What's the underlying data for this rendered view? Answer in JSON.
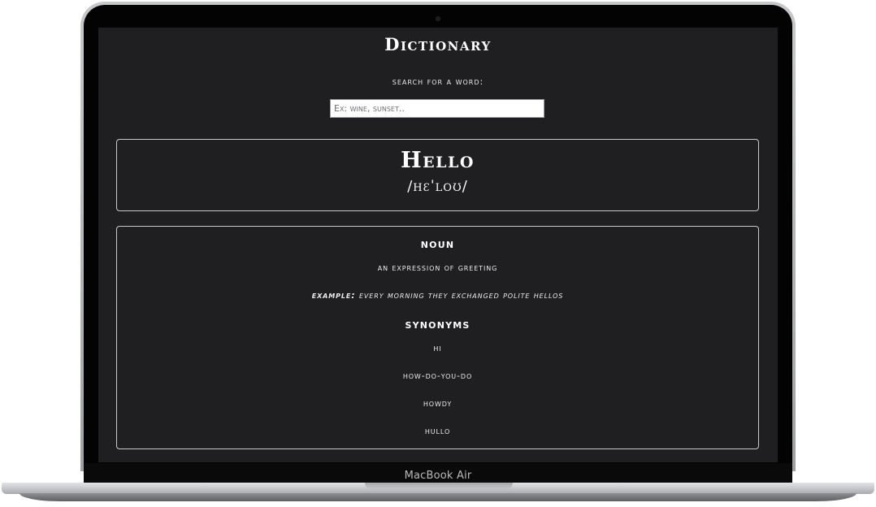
{
  "device": {
    "label": "MacBook Air"
  },
  "app": {
    "title": "Dictionary",
    "search": {
      "label": "search for a word:",
      "placeholder": "Ex: wine, sunset..",
      "value": ""
    },
    "entry": {
      "word": "Hello",
      "phonetic": "/hɛˈloʊ/"
    },
    "meaning": {
      "part_of_speech": "noun",
      "definition": "an expression of greeting",
      "example_label": "Example:",
      "example_text": "every morning they exchanged polite hellos",
      "synonyms_heading": "synonyms",
      "synonyms": [
        "hi",
        "how-do-you-do",
        "howdy",
        "hullo"
      ]
    }
  },
  "colors": {
    "screen_background": "#1f1f22",
    "text": "#ffffff",
    "card_border": "#c9c9cc",
    "input_background": "#ffffff"
  }
}
